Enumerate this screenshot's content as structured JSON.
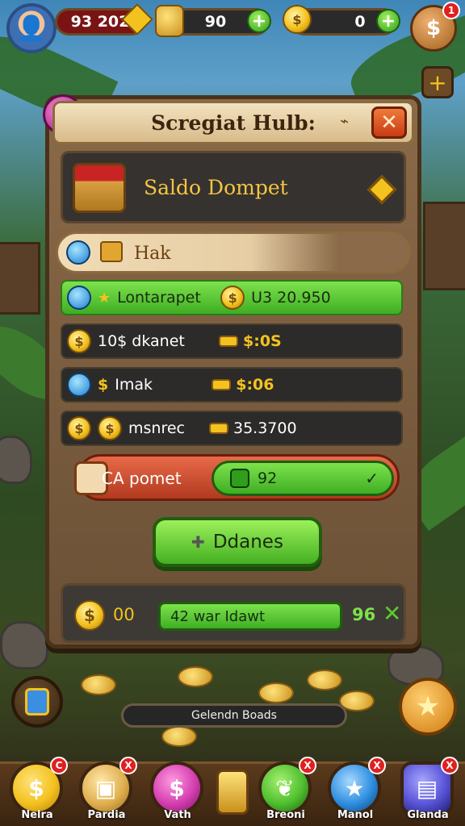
{
  "hud": {
    "player_score": "93 202",
    "gold_value": "90",
    "coins_value": "0",
    "shop_badge": "1"
  },
  "panel": {
    "title": "Scregiat Hulb:",
    "close_label": "✕",
    "saldo_label": "Saldo Dompet",
    "tab_label": "Hak"
  },
  "rows": [
    {
      "name": "Lontarapet",
      "value": "U3 20.950",
      "active": true
    },
    {
      "name": "10$ dkanet",
      "value": "$:0S",
      "active": false
    },
    {
      "name": "Imak",
      "value": "$:06",
      "active": false
    },
    {
      "name": "msnrec",
      "value": "35.3700",
      "active": false
    }
  ],
  "pomet": {
    "label": "CA pomet",
    "value": "92"
  },
  "action_button": {
    "label": "Ddanes"
  },
  "footer_box": {
    "left_value": "00",
    "bar_text": "42 war Idawt",
    "right_value": "96"
  },
  "search": {
    "text": "Gelendn Boads"
  },
  "nav": [
    {
      "label": "Nelra",
      "color": "#f3c21f",
      "icon": "dollar-icon",
      "badge": "C"
    },
    {
      "label": "Pardia",
      "color": "#e0b050",
      "icon": "box-icon",
      "badge": "X"
    },
    {
      "label": "Vath",
      "color": "#d43fb0",
      "icon": "dollar-icon",
      "badge": ""
    },
    {
      "label": "Breoni",
      "color": "#4fbf2f",
      "icon": "leaf-icon",
      "badge": "X"
    },
    {
      "label": "Manol",
      "color": "#2f8fe0",
      "icon": "star-icon",
      "badge": "X"
    },
    {
      "label": "Glanda",
      "color": "#5a56d8",
      "icon": "cart-icon",
      "badge": "X"
    }
  ],
  "colors": {
    "accent_green": "#5acb2a",
    "gold": "#f3c21f",
    "panel_brown": "#6b5036",
    "danger_red": "#c73b14"
  }
}
